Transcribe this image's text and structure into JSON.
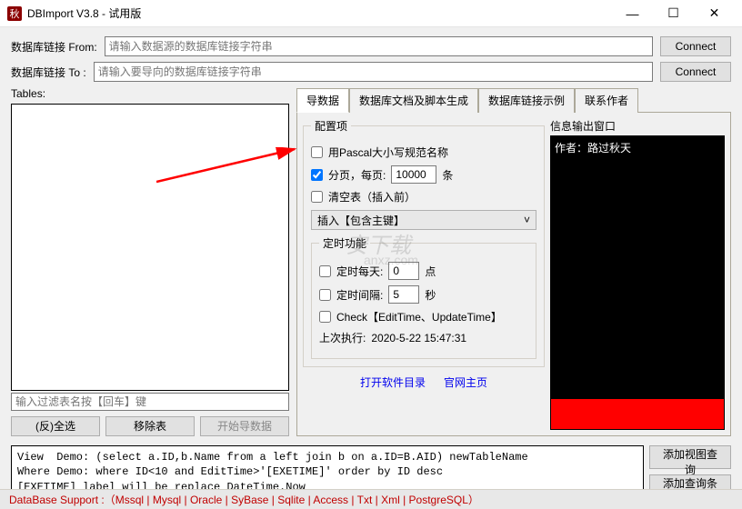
{
  "titlebar": {
    "icon_text": "秋",
    "title": "DBImport V3.8 - 试用版"
  },
  "conn": {
    "from_label": "数据库链接 From:",
    "from_placeholder": "请输入数据源的数据库链接字符串",
    "to_label": "数据库链接 To :",
    "to_placeholder": "请输入要导向的数据库链接字符串",
    "connect_btn": "Connect"
  },
  "tables": {
    "label": "Tables:",
    "filter_placeholder": "输入过滤表名按【回车】键",
    "select_all_btn": "(反)全选",
    "remove_btn": "移除表",
    "start_btn": "开始导数据"
  },
  "tabs": {
    "t1": "导数据",
    "t2": "数据库文档及脚本生成",
    "t3": "数据库链接示例",
    "t4": "联系作者"
  },
  "config": {
    "group_title": "配置项",
    "pascal_label": "用Pascal大小写规范名称",
    "paging_label": "分页，每页:",
    "paging_value": "10000",
    "paging_suffix": "条",
    "clear_label": "清空表（插入前）",
    "insert_dropdown": "插入【包含主键】",
    "timer_group_title": "定时功能",
    "daily_label": "定时每天:",
    "daily_value": "0",
    "daily_suffix": "点",
    "interval_label": "定时间隔:",
    "interval_value": "5",
    "interval_suffix": "秒",
    "check_label": "Check【EditTime、UpdateTime】",
    "last_label": "上次执行:",
    "last_value": "2020-5-22 15:47:31",
    "open_dir_link": "打开软件目录",
    "web_link": "官网主页"
  },
  "info": {
    "label": "信息输出窗口",
    "author_text": "作者：路过秋天"
  },
  "demo": {
    "line1": "View  Demo: (select a.ID,b.Name from a left join b on a.ID=B.AID) newTableName",
    "line2": "Where Demo: where ID<10 and EditTime>'[EXETIME]' order by ID desc",
    "line3": "[EXETIME] label will be replace DateTime.Now"
  },
  "bottom_btns": {
    "add_view": "添加视图查询",
    "add_cond": "添加查询条件"
  },
  "statusbar": {
    "text": "DataBase Support :（Mssql | Mysql | Oracle | SyBase | Sqlite | Access | Txt | Xml | PostgreSQL）"
  },
  "watermark": {
    "main": "安下载",
    "sub": "anxz.com"
  }
}
